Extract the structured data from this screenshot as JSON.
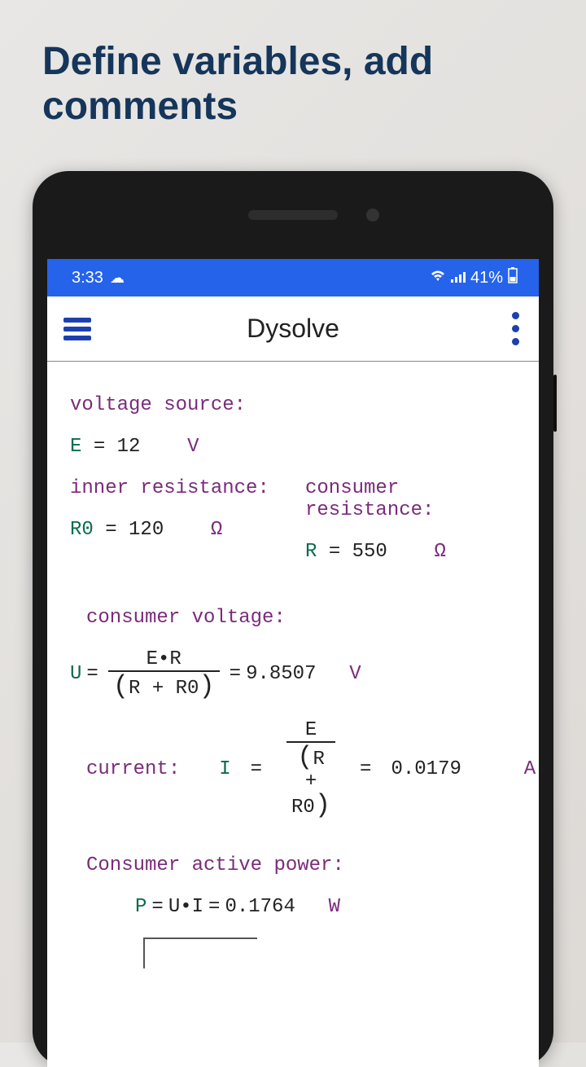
{
  "promo": {
    "title": "Define variables, add comments"
  },
  "status": {
    "time": "3:33",
    "battery": "41%"
  },
  "app": {
    "title": "Dysolve"
  },
  "c": {
    "voltage_source": "voltage source:",
    "inner_res": "inner resistance:",
    "consumer_res": "consumer resistance:",
    "consumer_voltage": "consumer voltage:",
    "current": "current:",
    "consumer_power": "Consumer active power:"
  },
  "v": {
    "E": "E",
    "R0": "R0",
    "R": "R",
    "U": "U",
    "I": "I",
    "P": "P"
  },
  "vals": {
    "E": "12",
    "R0": "120",
    "R": "550",
    "U": "9.8507",
    "I": "0.0179",
    "P": "0.1764"
  },
  "units": {
    "V": "V",
    "Ohm": "Ω",
    "A": "A",
    "W": "W"
  },
  "ops": {
    "eq": " = ",
    "plus": " + ",
    "mul": "•"
  },
  "expr": {
    "E_times_R": "E•R",
    "R_plus_R0_open": "(",
    "R_plus_R0_close": ")",
    "U_times_I": "U•I"
  }
}
